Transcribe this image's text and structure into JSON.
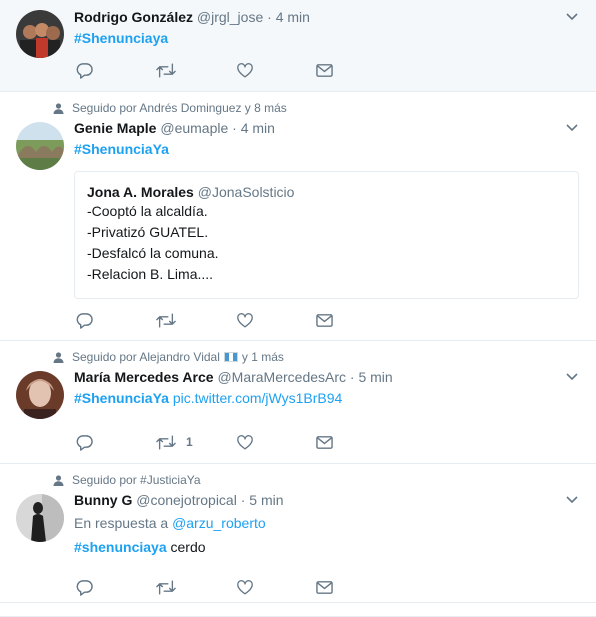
{
  "tweets": [
    {
      "context": "",
      "name": "Rodrigo González",
      "handle": "@jrgl_jose",
      "time": "· 4 min",
      "hashtag": "#Shenunciaya",
      "retweet_count": ""
    },
    {
      "context": "Seguido por Andrés Dominguez y 8 más",
      "name": "Genie Maple",
      "handle": "@eumaple",
      "time": "· 4 min",
      "hashtag": "#ShenunciaYa",
      "quote": {
        "name": "Jona A. Morales",
        "handle": "@JonaSolsticio",
        "lines": [
          "-Cooptó la alcaldía.",
          "-Privatizó GUATEL.",
          "-Desfalcó la comuna.",
          "-Relacion B. Lima...."
        ]
      },
      "retweet_count": ""
    },
    {
      "context_prefix": "Seguido por Alejandro Vidal",
      "context_suffix": "y 1 más",
      "name": "María Mercedes Arce",
      "handle": "@MaraMercedesArc",
      "time": "· 5 min",
      "hashtag": "#ShenunciaYa",
      "link": "pic.twitter.com/jWys1BrB94",
      "retweet_count": "1"
    },
    {
      "context": "Seguido por #JusticiaYa",
      "name": "Bunny G",
      "handle": "@conejotropical",
      "time": "· 5 min",
      "reply_prefix": "En respuesta a",
      "reply_to": "@arzu_roberto",
      "hashtag": "#shenunciaya",
      "text": "cerdo",
      "retweet_count": ""
    }
  ],
  "colors": {
    "accent": "#1da1f2",
    "muted": "#657786",
    "border": "#e6ecf0",
    "highlight_bg": "#f5f8fa"
  },
  "icons": [
    "person-icon",
    "reply-icon",
    "retweet-icon",
    "like-icon",
    "direct-message-icon",
    "caret-down-icon",
    "guatemala-flag-icon"
  ]
}
